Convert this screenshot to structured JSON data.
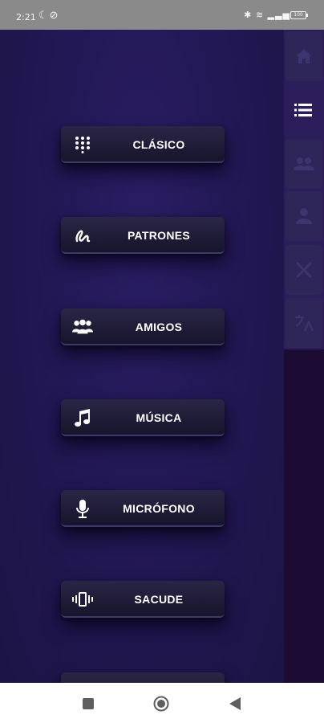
{
  "status_bar": {
    "time": "2:21",
    "left_icons": [
      "moon-icon",
      "do-not-disturb-icon"
    ],
    "right_icons": [
      "bluetooth-icon",
      "wifi-icon",
      "signal-icon"
    ],
    "battery": "100"
  },
  "menu": {
    "items": [
      {
        "label": "CLÁSICO",
        "icon": "dialpad-icon"
      },
      {
        "label": "PATRONES",
        "icon": "pattern-icon"
      },
      {
        "label": "AMIGOS",
        "icon": "group-icon"
      },
      {
        "label": "MÚSICA",
        "icon": "music-note-icon"
      },
      {
        "label": "MICRÓFONO",
        "icon": "microphone-icon"
      },
      {
        "label": "SACUDE",
        "icon": "vibrate-icon"
      },
      {
        "label": "",
        "icon": ""
      }
    ]
  },
  "rail": {
    "tabs": [
      "home-icon",
      "list-icon",
      "friends-icon",
      "person-icon",
      "tools-icon",
      "translate-icon"
    ],
    "selected": "list-icon"
  },
  "nav_bar": {
    "buttons": [
      "recents-button",
      "home-button",
      "back-button"
    ]
  },
  "colors": {
    "background": "#1f1746",
    "button": "#1f1b38",
    "rail": "#2b1e5a",
    "rail_bottom": "#1c0b33",
    "text": "#ffffff"
  }
}
